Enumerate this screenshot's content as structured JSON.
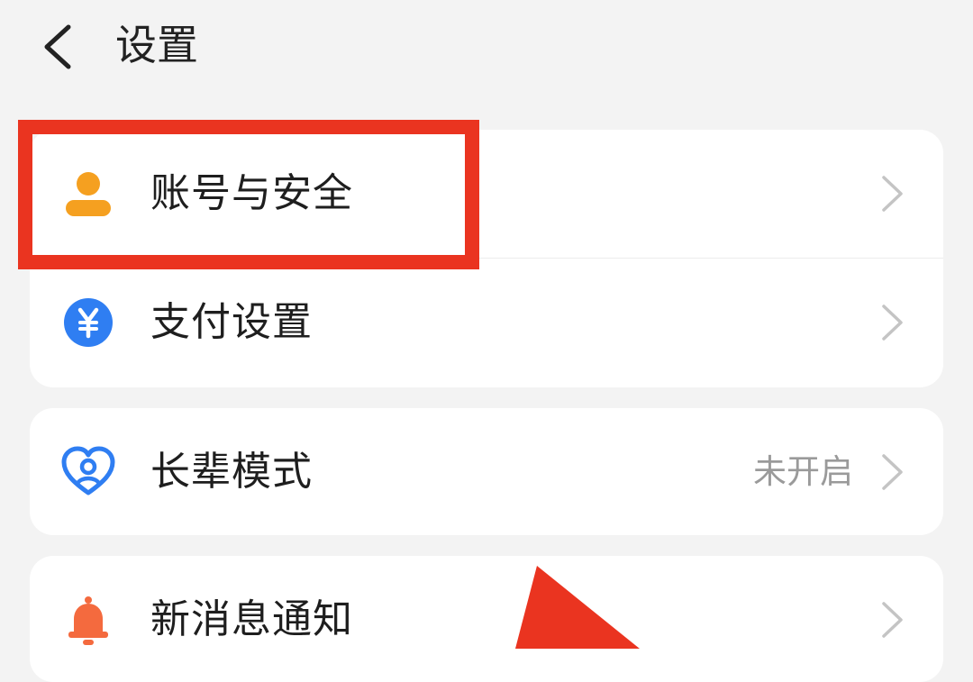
{
  "header": {
    "back_icon": "chevron-left-icon",
    "title": "设置"
  },
  "sections": [
    {
      "items": [
        {
          "icon": "user-icon",
          "label": "账号与安全",
          "value": "",
          "icon_color": "#f5a020"
        },
        {
          "icon": "yuan-icon",
          "label": "支付设置",
          "value": "",
          "icon_color": "#2f7ef2"
        }
      ]
    },
    {
      "items": [
        {
          "icon": "heart-person-icon",
          "label": "长辈模式",
          "value": "未开启",
          "icon_color": "#2f7ef2"
        }
      ]
    },
    {
      "items": [
        {
          "icon": "bell-icon",
          "label": "新消息通知",
          "value": "",
          "icon_color": "#f46a3e"
        }
      ]
    }
  ],
  "annotations": {
    "highlight_color": "#ea3420",
    "highlighted_item": "账号与安全"
  },
  "colors": {
    "background": "#f3f3f3",
    "card": "#ffffff",
    "text_primary": "#1e1e1e",
    "text_secondary": "#9a9a9a",
    "chevron": "#c4c4c4"
  }
}
